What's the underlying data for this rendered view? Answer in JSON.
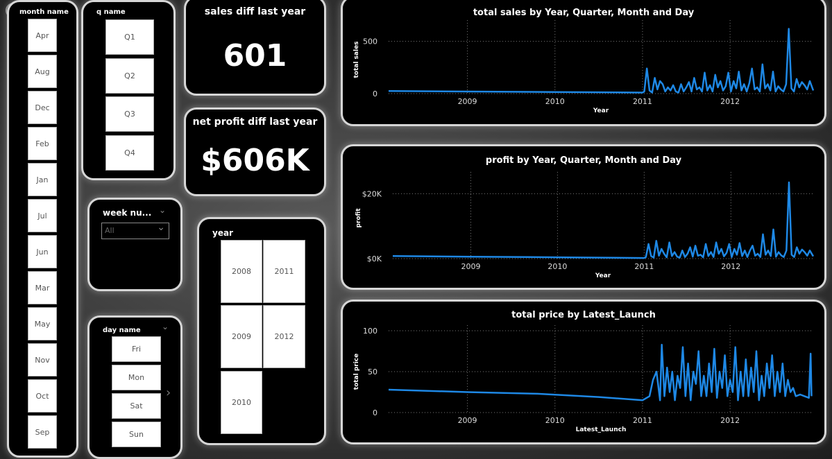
{
  "slicers": {
    "month": {
      "title": "month name",
      "items": [
        "Apr",
        "Aug",
        "Dec",
        "Feb",
        "Jan",
        "Jul",
        "Jun",
        "Mar",
        "May",
        "Nov",
        "Oct",
        "Sep"
      ]
    },
    "quarter": {
      "title": "q name",
      "items": [
        "Q1",
        "Q2",
        "Q3",
        "Q4"
      ]
    },
    "week": {
      "title": "week nu...",
      "value": "All"
    },
    "day": {
      "title": "day name",
      "items": [
        "Fri",
        "Mon",
        "Sat",
        "Sun"
      ]
    },
    "year": {
      "title": "year",
      "items": [
        "2008",
        "2011",
        "2009",
        "2012",
        "2010"
      ]
    }
  },
  "kpis": {
    "sales_diff": {
      "title": "sales diff last year",
      "value": "601"
    },
    "profit_diff": {
      "title": "net profit diff last year",
      "value": "$606K"
    }
  },
  "colors": {
    "accent": "#1e88e5",
    "card_border": "#d6d6d6",
    "card_bg": "#000000"
  },
  "icons": {
    "back": "back-arrow-icon",
    "dropdown": "chevron-down-icon",
    "next": "chevron-right-icon"
  },
  "chart_data": [
    {
      "type": "line",
      "title": "total sales by Year, Quarter, Month and Day",
      "xlabel": "Year",
      "ylabel": "total sales",
      "xlim": [
        2008.1,
        2012.95
      ],
      "ylim": [
        0,
        650
      ],
      "xticks": [
        2009,
        2010,
        2011,
        2012
      ],
      "yticks": [
        0,
        500
      ],
      "ytick_labels": [
        "0",
        "500"
      ],
      "grid": true,
      "series": [
        {
          "x": [
            2008.1,
            2009.0,
            2010.0,
            2011.0,
            2011.02,
            2011.05,
            2011.08,
            2011.11,
            2011.14,
            2011.17,
            2011.2,
            2011.23,
            2011.26,
            2011.29,
            2011.32,
            2011.35,
            2011.38,
            2011.41,
            2011.44,
            2011.47,
            2011.5,
            2011.53,
            2011.56,
            2011.59,
            2011.62,
            2011.65,
            2011.68,
            2011.71,
            2011.74,
            2011.77,
            2011.8,
            2011.83,
            2011.86,
            2011.89,
            2011.92,
            2011.95,
            2011.98,
            2012.01,
            2012.04,
            2012.07,
            2012.1,
            2012.13,
            2012.16,
            2012.19,
            2012.22,
            2012.25,
            2012.28,
            2012.31,
            2012.34,
            2012.37,
            2012.4,
            2012.43,
            2012.46,
            2012.49,
            2012.52,
            2012.55,
            2012.58,
            2012.61,
            2012.64,
            2012.67,
            2012.7,
            2012.73,
            2012.76,
            2012.79,
            2012.82,
            2012.85,
            2012.88,
            2012.91,
            2012.95
          ],
          "y": [
            25,
            20,
            15,
            10,
            20,
            240,
            30,
            10,
            150,
            40,
            120,
            90,
            20,
            60,
            30,
            80,
            20,
            10,
            90,
            20,
            60,
            110,
            20,
            150,
            40,
            60,
            20,
            200,
            30,
            80,
            20,
            180,
            60,
            120,
            30,
            70,
            200,
            20,
            120,
            50,
            210,
            30,
            90,
            20,
            100,
            240,
            40,
            60,
            20,
            280,
            50,
            90,
            30,
            210,
            20,
            70,
            40,
            20,
            90,
            620,
            50,
            20,
            140,
            60,
            110,
            80,
            40,
            120,
            30
          ]
        }
      ]
    },
    {
      "type": "line",
      "title": "profit by Year, Quarter, Month and Day",
      "xlabel": "Year",
      "ylabel": "profit",
      "xlim": [
        2008.1,
        2012.95
      ],
      "ylim": [
        0,
        25000
      ],
      "xticks": [
        2009,
        2010,
        2011,
        2012
      ],
      "yticks": [
        0,
        20000
      ],
      "ytick_labels": [
        "$0K",
        "$20K"
      ],
      "grid": true,
      "series": [
        {
          "x": [
            2008.1,
            2009.0,
            2010.0,
            2011.0,
            2011.02,
            2011.05,
            2011.08,
            2011.11,
            2011.14,
            2011.17,
            2011.2,
            2011.23,
            2011.26,
            2011.29,
            2011.32,
            2011.35,
            2011.38,
            2011.41,
            2011.44,
            2011.47,
            2011.5,
            2011.53,
            2011.56,
            2011.59,
            2011.62,
            2011.65,
            2011.68,
            2011.71,
            2011.74,
            2011.77,
            2011.8,
            2011.83,
            2011.86,
            2011.89,
            2011.92,
            2011.95,
            2011.98,
            2012.01,
            2012.04,
            2012.07,
            2012.1,
            2012.13,
            2012.16,
            2012.19,
            2012.22,
            2012.25,
            2012.28,
            2012.31,
            2012.34,
            2012.37,
            2012.4,
            2012.43,
            2012.46,
            2012.49,
            2012.52,
            2012.55,
            2012.58,
            2012.61,
            2012.64,
            2012.67,
            2012.7,
            2012.73,
            2012.76,
            2012.79,
            2012.82,
            2012.85,
            2012.88,
            2012.91,
            2012.95
          ],
          "y": [
            800,
            600,
            400,
            200,
            500,
            4500,
            800,
            300,
            5500,
            900,
            3000,
            1500,
            400,
            5000,
            800,
            2000,
            600,
            300,
            2500,
            500,
            1500,
            3500,
            600,
            4000,
            900,
            1200,
            400,
            4500,
            800,
            2000,
            500,
            5000,
            1500,
            3000,
            700,
            1800,
            4500,
            500,
            3000,
            1200,
            4800,
            800,
            2500,
            500,
            2500,
            4000,
            900,
            1500,
            500,
            7500,
            1200,
            2500,
            800,
            9000,
            600,
            2000,
            1000,
            500,
            2500,
            23500,
            1200,
            500,
            3500,
            1500,
            2800,
            2000,
            900,
            2500,
            700
          ]
        }
      ]
    },
    {
      "type": "line",
      "title": "total price by Latest_Launch",
      "xlabel": "Latest_Launch",
      "ylabel": "total price",
      "xlim": [
        2008.1,
        2012.95
      ],
      "ylim": [
        0,
        100
      ],
      "xticks": [
        2009,
        2010,
        2011,
        2012
      ],
      "yticks": [
        0,
        50,
        100
      ],
      "ytick_labels": [
        "0",
        "50",
        "100"
      ],
      "grid": true,
      "series": [
        {
          "x": [
            2008.1,
            2009.0,
            2009.8,
            2010.5,
            2011.0,
            2011.08,
            2011.12,
            2011.16,
            2011.2,
            2011.22,
            2011.25,
            2011.28,
            2011.31,
            2011.34,
            2011.37,
            2011.4,
            2011.43,
            2011.46,
            2011.49,
            2011.52,
            2011.55,
            2011.58,
            2011.61,
            2011.64,
            2011.67,
            2011.7,
            2011.73,
            2011.76,
            2011.79,
            2011.82,
            2011.85,
            2011.88,
            2011.91,
            2011.94,
            2011.97,
            2012.0,
            2012.03,
            2012.06,
            2012.09,
            2012.12,
            2012.15,
            2012.18,
            2012.21,
            2012.24,
            2012.27,
            2012.3,
            2012.33,
            2012.36,
            2012.39,
            2012.42,
            2012.45,
            2012.48,
            2012.51,
            2012.54,
            2012.57,
            2012.6,
            2012.63,
            2012.66,
            2012.69,
            2012.72,
            2012.75,
            2012.8,
            2012.85,
            2012.9,
            2012.92,
            2012.93
          ],
          "y": [
            28,
            25,
            23,
            19,
            15,
            20,
            40,
            50,
            15,
            83,
            20,
            55,
            25,
            50,
            15,
            45,
            30,
            80,
            20,
            60,
            15,
            50,
            35,
            75,
            20,
            45,
            20,
            60,
            25,
            78,
            18,
            50,
            30,
            70,
            20,
            40,
            25,
            80,
            15,
            50,
            20,
            65,
            20,
            55,
            25,
            75,
            15,
            45,
            20,
            60,
            30,
            70,
            20,
            50,
            25,
            60,
            20,
            40,
            25,
            30,
            20,
            22,
            20,
            18,
            72,
            20
          ]
        }
      ]
    }
  ]
}
